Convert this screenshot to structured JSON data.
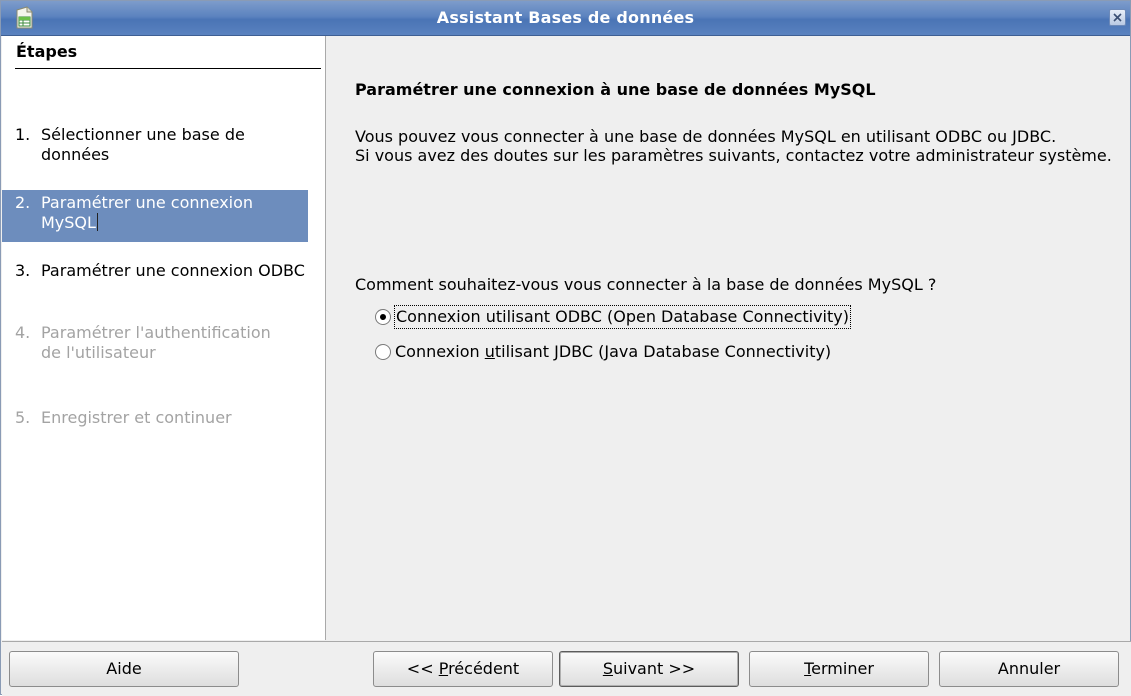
{
  "window": {
    "title": "Assistant Bases de données",
    "icon": "database-app-icon",
    "close_icon": "close-icon"
  },
  "steps": {
    "heading": "Étapes",
    "items": [
      {
        "num": "1.",
        "label": "Sélectionner une base de données",
        "state": "normal"
      },
      {
        "num": "2.",
        "label": "Paramétrer une connexion MySQL",
        "state": "active"
      },
      {
        "num": "3.",
        "label": "Paramétrer une connexion ODBC",
        "state": "normal"
      },
      {
        "num": "4.",
        "label": "Paramétrer l'authentification de l'utilisateur",
        "state": "disabled"
      },
      {
        "num": "5.",
        "label": "Enregistrer et continuer",
        "state": "disabled"
      }
    ]
  },
  "page": {
    "title": "Paramétrer une connexion à une base de données MySQL",
    "intro_line1": "Vous pouvez vous connecter à une base de données MySQL en utilisant ODBC ou JDBC.",
    "intro_line2": "Si vous avez des doutes sur les paramètres suivants, contactez votre administrateur système.",
    "question": "Comment souhaitez-vous vous connecter à la base de données MySQL ?",
    "options": [
      {
        "label": "Connexion utilisant ODBC (Open Database Connectivity)",
        "checked": true
      },
      {
        "label_pre": "Connexion ",
        "label_accel": "u",
        "label_post": "tilisant JDBC (Java Database Connectivity)",
        "checked": false
      }
    ]
  },
  "buttons": {
    "help": "Aide",
    "back_prefix": "<< ",
    "back_accel": "P",
    "back_rest": "récédent",
    "next_accel": "S",
    "next_rest": "uivant >>",
    "finish_accel": "T",
    "finish_rest": "erminer",
    "cancel": "Annuler"
  },
  "colors": {
    "titlebar": "#5c83bf",
    "selection": "#6d8dbd",
    "disabled_text": "#a3a3a3"
  }
}
